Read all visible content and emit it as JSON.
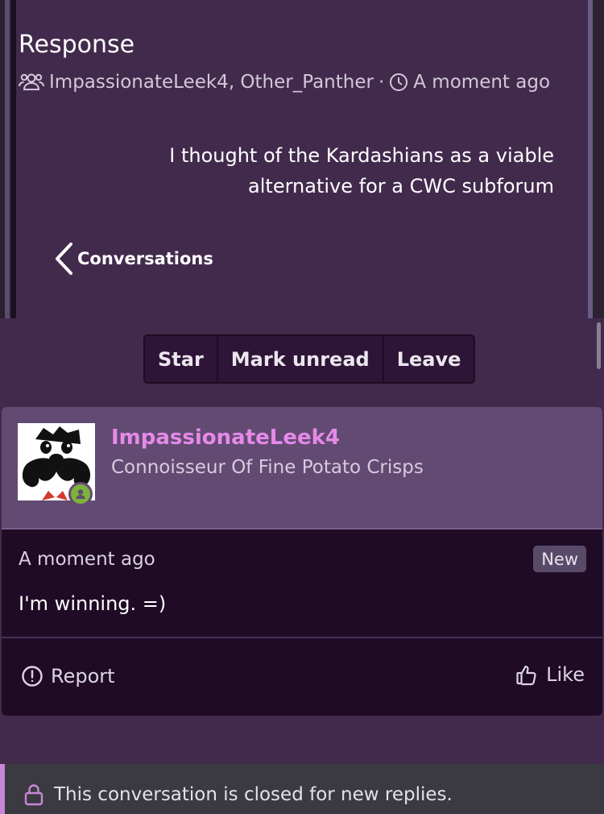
{
  "conversation": {
    "title": "Response",
    "participants": "ImpassionateLeek4, Other_Panther",
    "separator": "·",
    "time": "A moment ago",
    "quote": "I thought of the Kardashians as a viable alternative for a CWC subforum",
    "back_label": "Conversations"
  },
  "actions": {
    "star": "Star",
    "mark_unread": "Mark unread",
    "leave": "Leave"
  },
  "message": {
    "username": "ImpassionateLeek4",
    "user_title": "Connoisseur Of Fine Potato Crisps",
    "time": "A moment ago",
    "badge": "New",
    "body": "I'm winning. =)",
    "report_label": "Report",
    "like_label": "Like"
  },
  "notice": {
    "text": "This conversation is closed for new replies."
  },
  "colors": {
    "panel": "#422a4d",
    "card": "#1f0b26",
    "user_header": "#634a72",
    "username": "#e58ae8",
    "accent": "#c886d8",
    "online": "#7db33a"
  },
  "icons": {
    "participants": "users-icon",
    "time": "clock-icon",
    "back": "chevron-left-icon",
    "report": "alert-circle-icon",
    "like": "thumbs-up-icon",
    "lock": "lock-icon",
    "online": "user-online-icon"
  }
}
